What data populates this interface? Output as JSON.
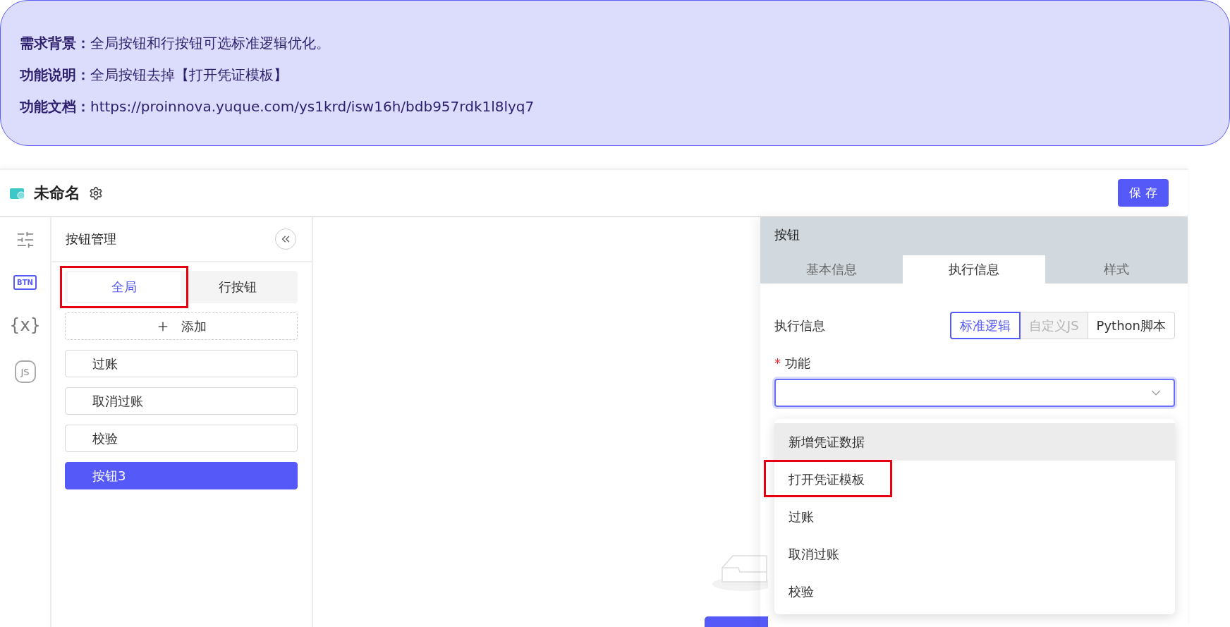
{
  "banner": {
    "lines": [
      {
        "label": "需求背景：",
        "text": "全局按钮和行按钮可选标准逻辑优化。"
      },
      {
        "label": "功能说明：",
        "text": "全局按钮去掉【打开凭证模板】"
      },
      {
        "label": "功能文档：",
        "text": "https://proinnova.yuque.com/ys1krd/isw16h/bdb957rdk1l8lyq7"
      }
    ]
  },
  "header": {
    "title": "未命名",
    "save_button": "保 存"
  },
  "rail": {
    "items": [
      {
        "kind": "sliders",
        "selected": false
      },
      {
        "kind": "badge",
        "label": "BTN",
        "selected": true
      },
      {
        "kind": "text",
        "label": "{x}",
        "selected": false
      },
      {
        "kind": "hexagon",
        "label": "JS",
        "selected": false
      }
    ]
  },
  "left_panel": {
    "title": "按钮管理",
    "tabs": [
      {
        "label": "全局",
        "selected": true,
        "highlighted": true
      },
      {
        "label": "行按钮",
        "selected": false,
        "highlighted": false
      }
    ],
    "add_button": "添加",
    "buttons": [
      {
        "label": "过账",
        "selected": false
      },
      {
        "label": "取消过账",
        "selected": false
      },
      {
        "label": "校验",
        "selected": false
      },
      {
        "label": "按钮3",
        "selected": true
      }
    ]
  },
  "right_panel": {
    "title": "按钮",
    "tabs": [
      {
        "label": "基本信息",
        "selected": false
      },
      {
        "label": "执行信息",
        "selected": true
      },
      {
        "label": "样式",
        "selected": false
      }
    ],
    "exec_label": "执行信息",
    "modes": [
      {
        "label": "标准逻辑",
        "selected": true,
        "disabled": false
      },
      {
        "label": "自定义JS",
        "selected": false,
        "disabled": true
      },
      {
        "label": "Python脚本",
        "selected": false,
        "disabled": false
      }
    ],
    "function_field": {
      "label": "功能",
      "required_mark": "*",
      "focused": true
    },
    "dropdown": {
      "items": [
        {
          "label": "新增凭证数据",
          "hovered": true,
          "highlighted": false
        },
        {
          "label": "打开凭证模板",
          "hovered": false,
          "highlighted": true
        },
        {
          "label": "过账",
          "hovered": false,
          "highlighted": false
        },
        {
          "label": "取消过账",
          "hovered": false,
          "highlighted": false
        },
        {
          "label": "校验",
          "hovered": false,
          "highlighted": false
        }
      ]
    }
  }
}
